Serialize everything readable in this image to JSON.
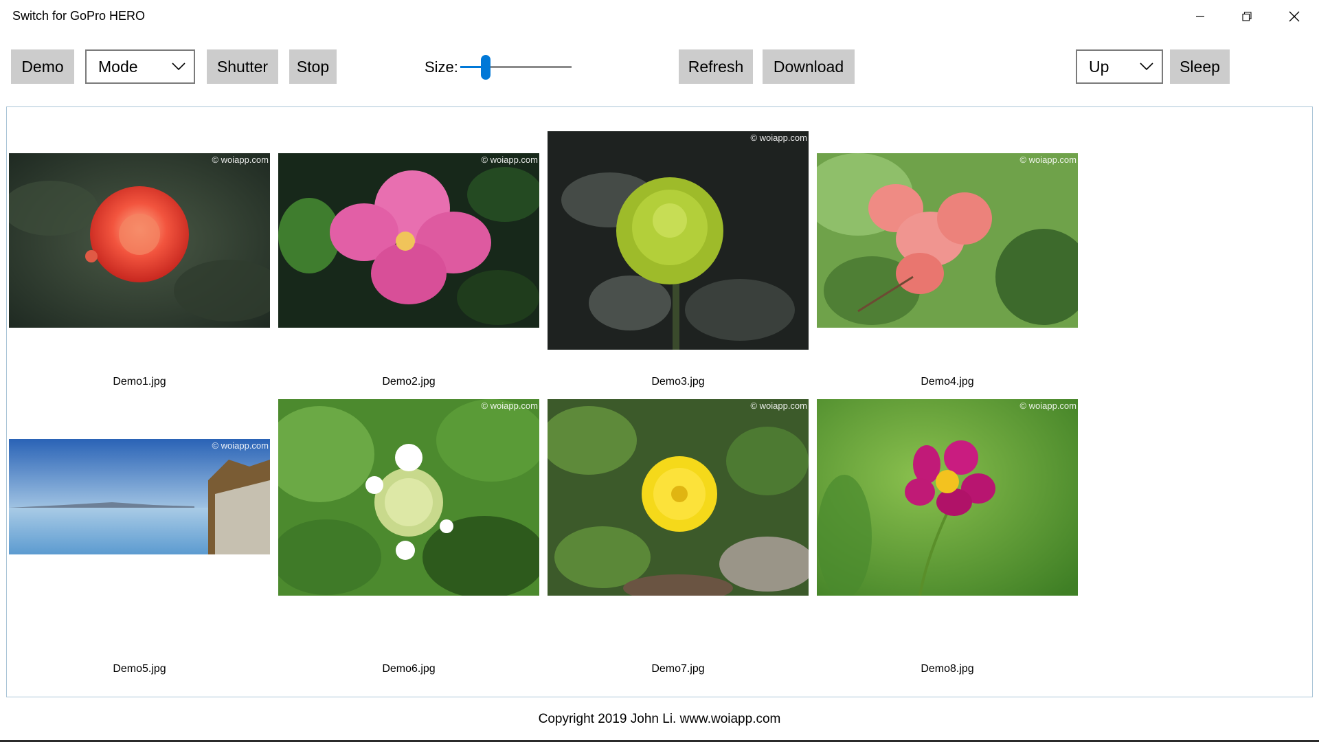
{
  "window": {
    "title": "Switch for GoPro HERO"
  },
  "toolbar": {
    "demo_label": "Demo",
    "mode_value": "Mode",
    "shutter_label": "Shutter",
    "stop_label": "Stop",
    "size_label": "Size:",
    "size_value_fraction": 0.2,
    "refresh_label": "Refresh",
    "download_label": "Download",
    "direction_value": "Up",
    "sleep_label": "Sleep"
  },
  "gallery": {
    "watermark": "© woiapp.com",
    "items": [
      {
        "filename": "Demo1.jpg",
        "subject": "red dahlia"
      },
      {
        "filename": "Demo2.jpg",
        "subject": "pink rose"
      },
      {
        "filename": "Demo3.jpg",
        "subject": "green chrysanthemum"
      },
      {
        "filename": "Demo4.jpg",
        "subject": "pink bougainvillea"
      },
      {
        "filename": "Demo5.jpg",
        "subject": "lake landscape"
      },
      {
        "filename": "Demo6.jpg",
        "subject": "white viburnum"
      },
      {
        "filename": "Demo7.jpg",
        "subject": "yellow daisy"
      },
      {
        "filename": "Demo8.jpg",
        "subject": "magenta cosmos"
      }
    ]
  },
  "footer": {
    "copyright": "Copyright 2019 John Li. www.woiapp.com"
  },
  "colors": {
    "accent": "#0078d7",
    "button_bg": "#cccccc",
    "gallery_border": "#a9c4d6"
  }
}
